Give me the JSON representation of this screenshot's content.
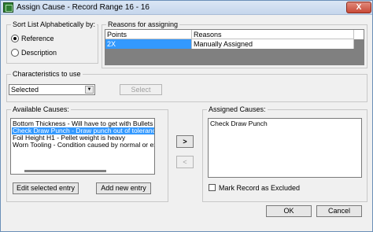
{
  "window": {
    "title": "Assign Cause - Record Range 16 - 16",
    "close_label": "X"
  },
  "sort": {
    "group_label": "Sort List Alphabetically by:",
    "options": [
      {
        "label": "Reference",
        "checked": true
      },
      {
        "label": "Description",
        "checked": false
      }
    ]
  },
  "reasons": {
    "group_label": "Reasons for assigning",
    "columns": [
      "Points",
      "Reasons"
    ],
    "rows": [
      {
        "points": "2X",
        "reason": "Manually Assigned"
      }
    ]
  },
  "characteristics": {
    "group_label": "Characteristics to use",
    "selected_value": "Selected",
    "select_button": "Select"
  },
  "available": {
    "group_label": "Available Causes:",
    "items": [
      "Bottom Thickness - Will have to get with Bullets on th",
      "Check Draw Punch - Draw punch out of tolerance",
      "Foil Height H1 - Pellet weight is heavy",
      "Worn Tooling - Condition caused by normal or expec"
    ],
    "selected_index": 1,
    "edit_button": "Edit selected entry",
    "add_button": "Add new entry"
  },
  "transfer": {
    "add_arrow": ">",
    "remove_arrow": "<"
  },
  "assigned": {
    "group_label": "Assigned Causes:",
    "items": [
      "Check Draw Punch"
    ],
    "exclude_label": "Mark Record as Excluded"
  },
  "footer": {
    "ok_label": "OK",
    "cancel_label": "Cancel"
  }
}
